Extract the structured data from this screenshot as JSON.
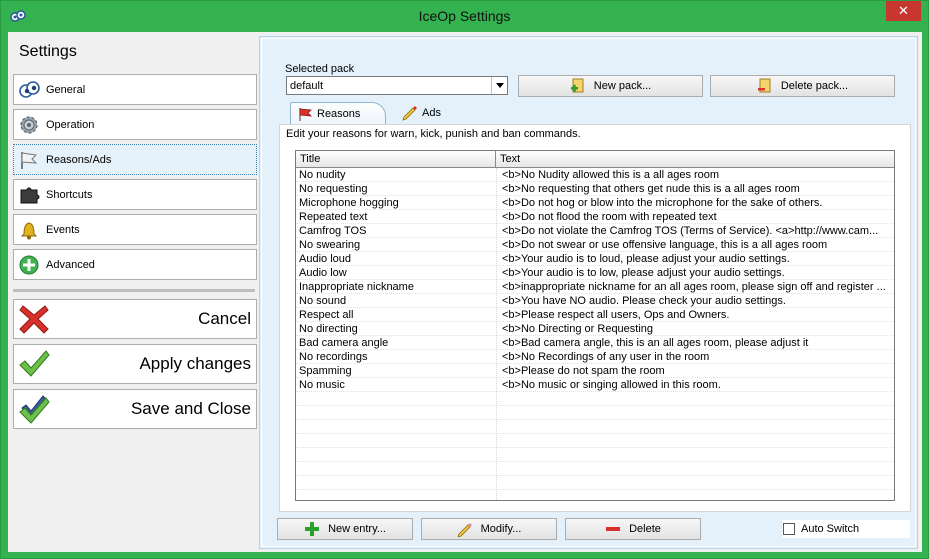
{
  "window": {
    "title": "IceOp Settings",
    "close_glyph": "✕"
  },
  "sidebar": {
    "title": "Settings",
    "items": [
      {
        "label": "General",
        "icon": "eyes-icon"
      },
      {
        "label": "Operation",
        "icon": "gear-icon"
      },
      {
        "label": "Reasons/Ads",
        "icon": "flag-icon"
      },
      {
        "label": "Shortcuts",
        "icon": "puzzle-icon"
      },
      {
        "label": "Events",
        "icon": "bell-icon"
      },
      {
        "label": "Advanced",
        "icon": "plus-circle-icon"
      }
    ],
    "selected": "Reasons/Ads",
    "actions": {
      "cancel": "Cancel",
      "apply": "Apply changes",
      "save_close": "Save and Close"
    }
  },
  "pack": {
    "label": "Selected pack",
    "selected": "default",
    "new_label": "New pack...",
    "delete_label": "Delete pack..."
  },
  "tabs": [
    {
      "label": "Reasons",
      "active": true
    },
    {
      "label": "Ads",
      "active": false
    }
  ],
  "reasons": {
    "help": "Edit your reasons for warn, kick, punish and ban commands.",
    "columns": [
      "Title",
      "Text"
    ],
    "rows": [
      [
        "No nudity",
        "<b>No Nudity allowed this is a all ages room"
      ],
      [
        "No requesting",
        "<b>No requesting that others get nude this is a all ages room"
      ],
      [
        "Microphone hogging",
        "<b>Do not hog or blow into the microphone for the sake of others."
      ],
      [
        "Repeated text",
        "<b>Do not flood the room with repeated text"
      ],
      [
        "Camfrog TOS",
        "<b>Do not violate the Camfrog TOS (Terms of Service). <a>http://www.cam..."
      ],
      [
        "No swearing",
        "<b>Do not swear or use offensive language, this is a all ages room"
      ],
      [
        "Audio loud",
        "<b>Your audio is to loud, please adjust your audio settings."
      ],
      [
        "Audio low",
        "<b>Your audio is to low, please adjust your audio settings."
      ],
      [
        "Inappropriate nickname",
        "<b>inappropriate nickname for an all ages room, please sign off and register ..."
      ],
      [
        "No sound",
        "<b>You have NO audio. Please check your audio settings."
      ],
      [
        "Respect all",
        "<b>Please respect all users, Ops and Owners."
      ],
      [
        "No directing",
        "<b>No Directing or Requesting"
      ],
      [
        "Bad camera angle",
        "<b>Bad camera angle, this is an all ages room, please adjust it"
      ],
      [
        "No recordings",
        "<b>No Recordings of any user in the room"
      ],
      [
        "Spamming",
        "<b>Please do not spam the room"
      ],
      [
        "No music",
        "<b>No music or singing allowed in this room."
      ]
    ]
  },
  "bottom": {
    "new_entry": "New entry...",
    "modify": "Modify...",
    "delete": "Delete",
    "auto_switch": "Auto Switch",
    "auto_switch_checked": false
  },
  "colors": {
    "window_frame": "#34b24f",
    "close_button": "#c7372f",
    "panel_bg": "#e4f1fa",
    "selected_item": "#e5f1fb"
  }
}
